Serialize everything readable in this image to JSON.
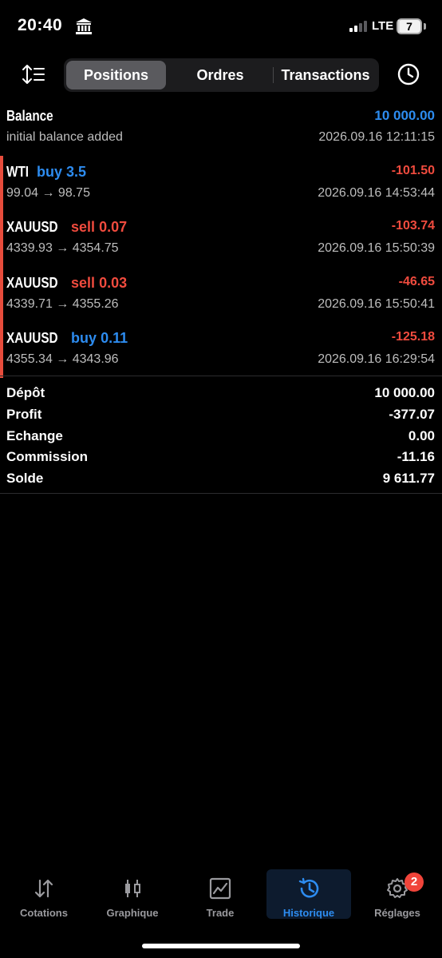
{
  "status": {
    "time": "20:40",
    "network": "LTE",
    "battery": "7",
    "battery_percent": 7
  },
  "toolbar": {
    "tabs": [
      "Positions",
      "Ordres",
      "Transactions"
    ],
    "active_tab": "Positions"
  },
  "balance": {
    "title": "Balance",
    "amount": "10 000.00",
    "note": "initial balance added",
    "date": "2026.09.16 12:11:15"
  },
  "trades": [
    {
      "symbol": "WTI",
      "type": "buy",
      "volume": "3.5",
      "prices": "99.04 → 98.75",
      "profit": "-101.50",
      "date": "2026.09.16 14:53:44"
    },
    {
      "symbol": "XAUUSD",
      "type": "sell",
      "volume": "0.07",
      "prices": "4339.93 → 4354.75",
      "profit": "-103.74",
      "date": "2026.09.16 15:50:39"
    },
    {
      "symbol": "XAUUSD",
      "type": "sell",
      "volume": "0.03",
      "prices": "4339.71 → 4355.26",
      "profit": "-46.65",
      "date": "2026.09.16 15:50:41"
    },
    {
      "symbol": "XAUUSD",
      "type": "buy",
      "volume": "0.11",
      "prices": "4355.34 → 4343.96",
      "profit": "-125.18",
      "date": "2026.09.16 16:29:54"
    }
  ],
  "totals": [
    {
      "label": "Dépôt",
      "value": "10 000.00"
    },
    {
      "label": "Profit",
      "value": "-377.07"
    },
    {
      "label": "Echange",
      "value": "0.00"
    },
    {
      "label": "Commission",
      "value": "-11.16"
    },
    {
      "label": "Solde",
      "value": "9 611.77"
    }
  ],
  "tabbar": {
    "items": [
      "Cotations",
      "Graphique",
      "Trade",
      "Historique",
      "Réglages"
    ],
    "active": "Historique",
    "settings_badge": "2"
  },
  "colors": {
    "accent_blue": "#2d8cf0",
    "loss_red": "#f04b3e",
    "background": "#000000"
  }
}
